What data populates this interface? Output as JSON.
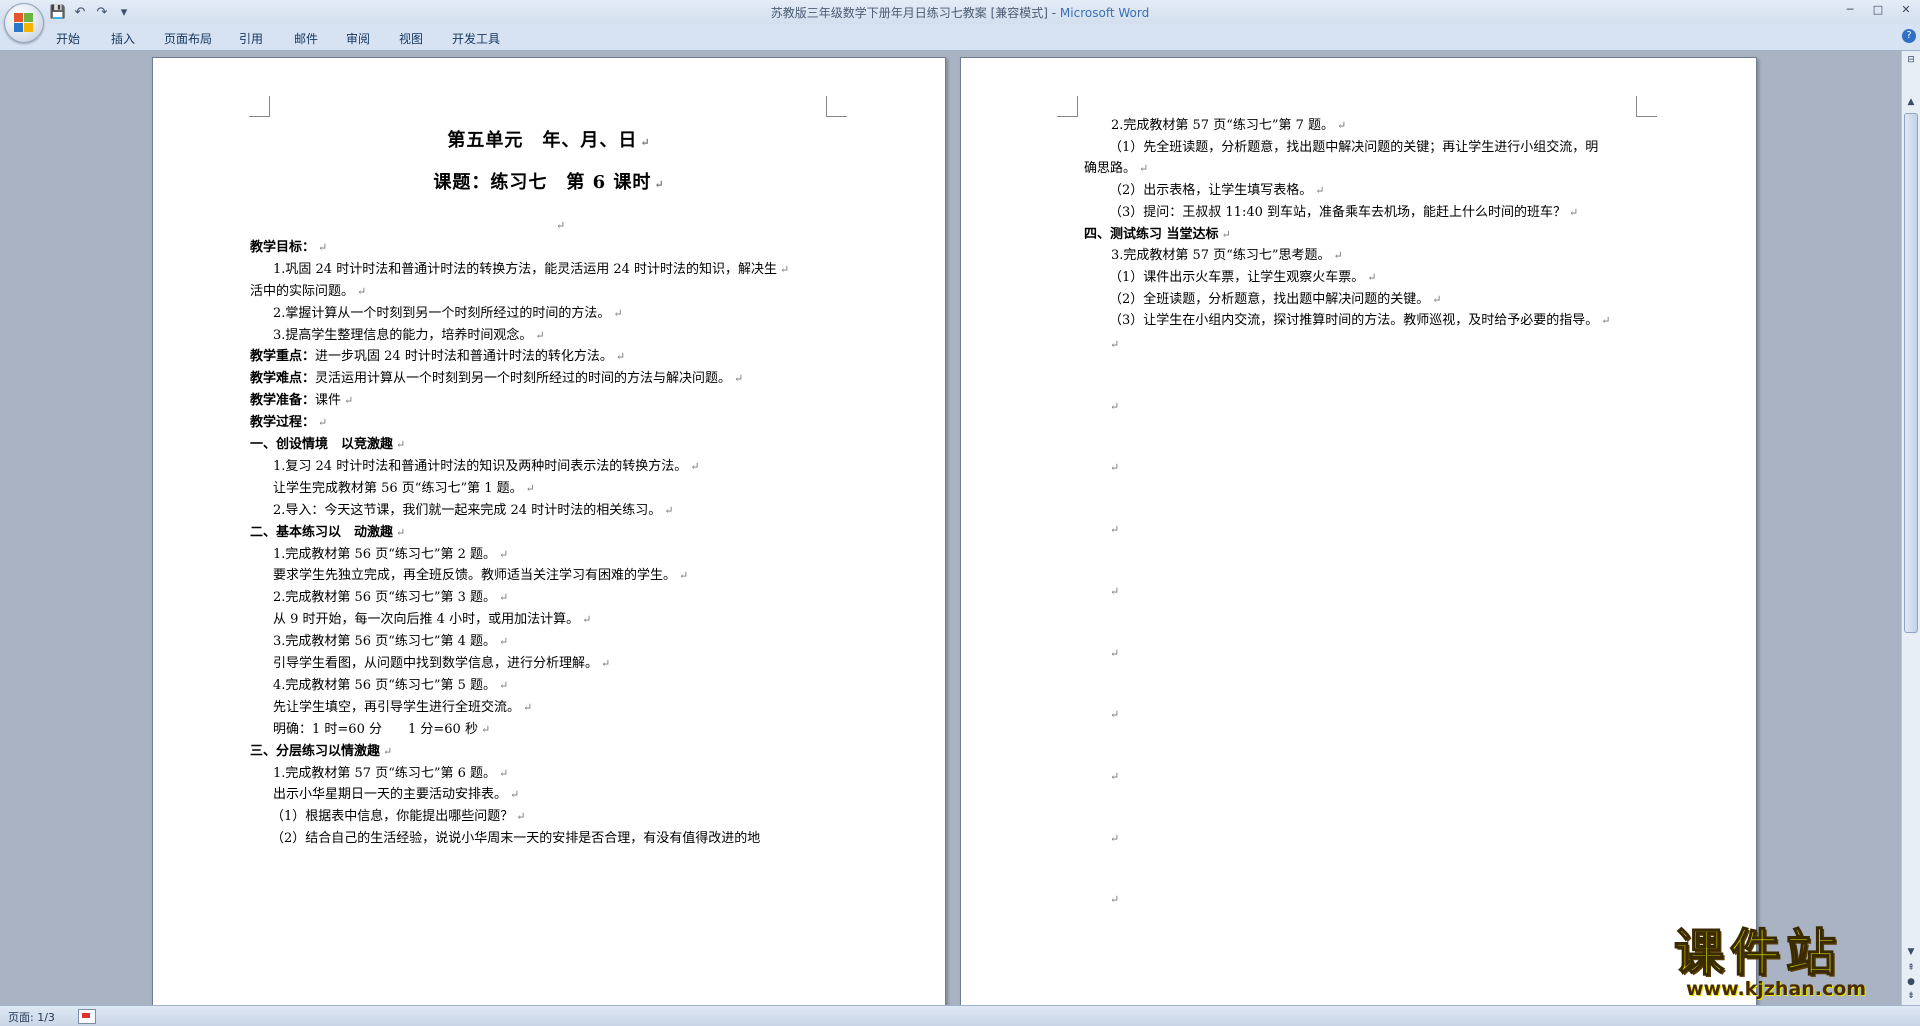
{
  "window": {
    "title_doc": "苏教版三年级数学下册年月日练习七教案 [兼容模式] - ",
    "title_app": "Microsoft Word",
    "controls": [
      "─",
      "□",
      "✕"
    ]
  },
  "quick_access": {
    "save": "💾",
    "undo": "↶",
    "redo": "↷",
    "more": "▾"
  },
  "ribbon": {
    "tabs": [
      "开始",
      "插入",
      "页面布局",
      "引用",
      "邮件",
      "审阅",
      "视图",
      "开发工具"
    ],
    "help": "?"
  },
  "page1": {
    "heading1": "第五单元　年、月、日",
    "heading2": "课题：练习七　第 6 课时",
    "lines": [
      {
        "t": "",
        "b": false
      },
      {
        "t": "教学目标：",
        "b": true
      },
      {
        "t": "1.巩固 24 时计时法和普通计时法的转换方法，能灵活运用 24 时计时法的知识，解决生",
        "b": false
      },
      {
        "t": "活中的实际问题。",
        "b": false
      },
      {
        "t": "2.掌握计算从一个时刻到另一个时刻所经过的时间的方法。",
        "b": false
      },
      {
        "t": "3.提高学生整理信息的能力，培养时间观念。",
        "b": false
      },
      {
        "label": "教学重点：",
        "t": "进一步巩固 24 时计时法和普通计时法的转化方法。"
      },
      {
        "label": "教学难点：",
        "t": "灵活运用计算从一个时刻到另一个时刻所经过的时间的方法与解决问题。"
      },
      {
        "label": "教学准备：",
        "t": "课件"
      },
      {
        "t": "教学过程：",
        "b": true
      },
      {
        "t": "一、创设情境　以竞激趣",
        "b": true
      },
      {
        "t": "1.复习 24 时计时法和普通计时法的知识及两种时间表示法的转换方法。",
        "b": false
      },
      {
        "t": "让学生完成教材第 56 页“练习七”第 1 题。",
        "b": false
      },
      {
        "t": "2.导入：今天这节课，我们就一起来完成 24 时计时法的相关练习。",
        "b": false
      },
      {
        "t": "二、基本练习以　动激趣",
        "b": true
      },
      {
        "t": "1.完成教材第 56 页“练习七”第 2 题。",
        "b": false
      },
      {
        "t": "要求学生先独立完成，再全班反馈。教师适当关注学习有困难的学生。",
        "b": false
      },
      {
        "t": "2.完成教材第 56 页“练习七”第 3 题。",
        "b": false
      },
      {
        "t": "从 9 时开始，每一次向后推 4 小时，或用加法计算。",
        "b": false
      },
      {
        "t": "3.完成教材第 56 页“练习七”第 4 题。",
        "b": false
      },
      {
        "t": "引导学生看图，从问题中找到数学信息，进行分析理解。",
        "b": false
      },
      {
        "t": "4.完成教材第 56 页“练习七”第 5 题。",
        "b": false
      },
      {
        "t": "先让学生填空，再引导学生进行全班交流。",
        "b": false
      },
      {
        "t": "明确：1 时=60 分　　1 分=60 秒",
        "b": false
      },
      {
        "t": "三、分层练习以情激趣",
        "b": true
      },
      {
        "t": "1.完成教材第 57 页“练习七”第 6 题。",
        "b": false
      },
      {
        "t": "出示小华星期日一天的主要活动安排表。",
        "b": false
      },
      {
        "t": "（1）根据表中信息，你能提出哪些问题？",
        "b": false
      },
      {
        "t": "（2）结合自己的生活经验，说说小华周末一天的安排是否合理，有没有值得改进的地",
        "b": false
      }
    ]
  },
  "page2": {
    "lines": [
      {
        "t": "2.完成教材第 57 页“练习七”第 7 题。",
        "b": false
      },
      {
        "t": "（1）先全班读题，分析题意，找出题中解决问题的关键；再让学生进行小组交流，明",
        "b": false
      },
      {
        "t": "确思路。",
        "b": false
      },
      {
        "t": "（2）出示表格，让学生填写表格。",
        "b": false
      },
      {
        "t": "（3）提问：王叔叔 11:40 到车站，准备乘车去机场，能赶上什么时间的班车？",
        "b": false
      },
      {
        "t": "四、测试练习 当堂达标",
        "b": true
      },
      {
        "t": "3.完成教材第 57 页“练习七”思考题。",
        "b": false
      },
      {
        "t": "（1）课件出示火车票，让学生观察火车票。",
        "b": false
      },
      {
        "t": "（2）全班读题，分析题意，找出题中解决问题的关键。",
        "b": false
      },
      {
        "t": "（3）让学生在小组内交流，探讨推算时间的方法。教师巡视，及时给予必要的指导。",
        "b": false
      }
    ],
    "empty_paragraph_count": 10
  },
  "paragraph_mark": "↵",
  "status": {
    "page": "页面: 1/3"
  },
  "watermark": {
    "main": "课件站",
    "url": "www.kjzhan.com"
  }
}
